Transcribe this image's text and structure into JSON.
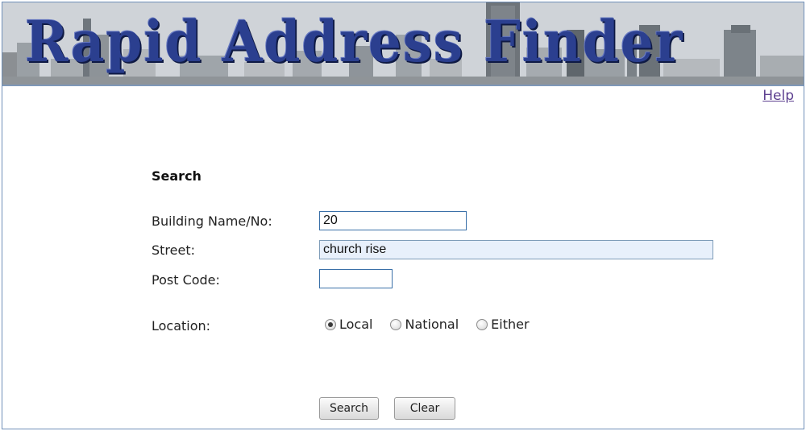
{
  "header": {
    "title": "Rapid Address Finder",
    "help_label": "Help"
  },
  "search": {
    "section_title": "Search",
    "building": {
      "label": "Building Name/No:",
      "value": "20"
    },
    "street": {
      "label": "Street:",
      "value": "church rise"
    },
    "postcode": {
      "label": "Post Code:",
      "value": ""
    },
    "location": {
      "label": "Location:",
      "selected": "Local",
      "options": [
        "Local",
        "National",
        "Either"
      ]
    },
    "buttons": {
      "search_label": "Search",
      "clear_label": "Clear"
    }
  },
  "colors": {
    "title_blue": "#2b3f8f",
    "frame_border": "#6f8fb8",
    "link_purple": "#5c3f8f",
    "input_border": "#3a70a8",
    "active_input_bg": "#e8f0fb"
  }
}
